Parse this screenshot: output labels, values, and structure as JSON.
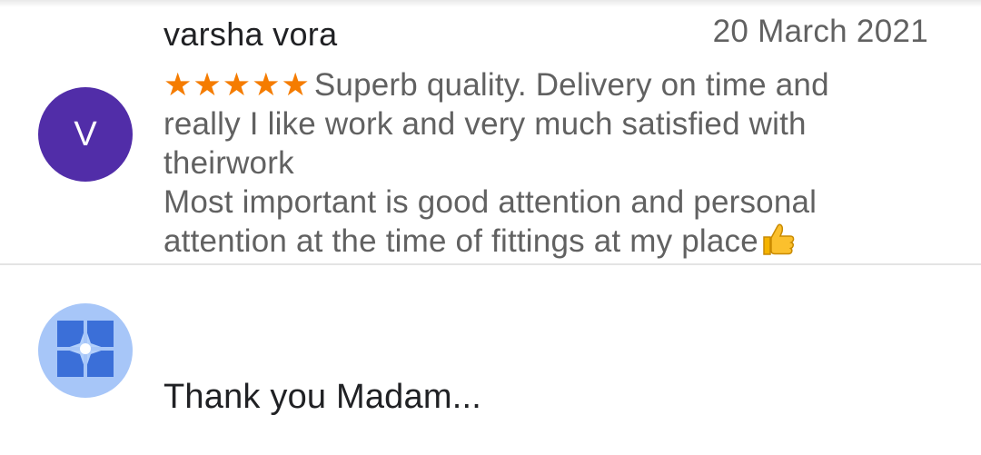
{
  "review": {
    "avatar_letter": "V",
    "reviewer_name": "varsha vora",
    "date": "20 March 2021",
    "stars": "★★★★★",
    "rating": 5,
    "text_line1": "Superb quality. Delivery on time and",
    "text_line2": "really I like work and very much satisfied with",
    "text_line3": "theirwork",
    "text_line4": "Most important is good attention and personal",
    "text_line5": "attention at the time of fittings at my place",
    "emoji": "thumbs-up-icon"
  },
  "reply": {
    "avatar_icon": "business-logo-icon",
    "text": "Thank you Madam..."
  },
  "colors": {
    "avatar_bg": "#512da8",
    "star_color": "#f57c00",
    "owner_avatar_bg": "#a7c6f8",
    "owner_logo": "#3b6fd8"
  }
}
